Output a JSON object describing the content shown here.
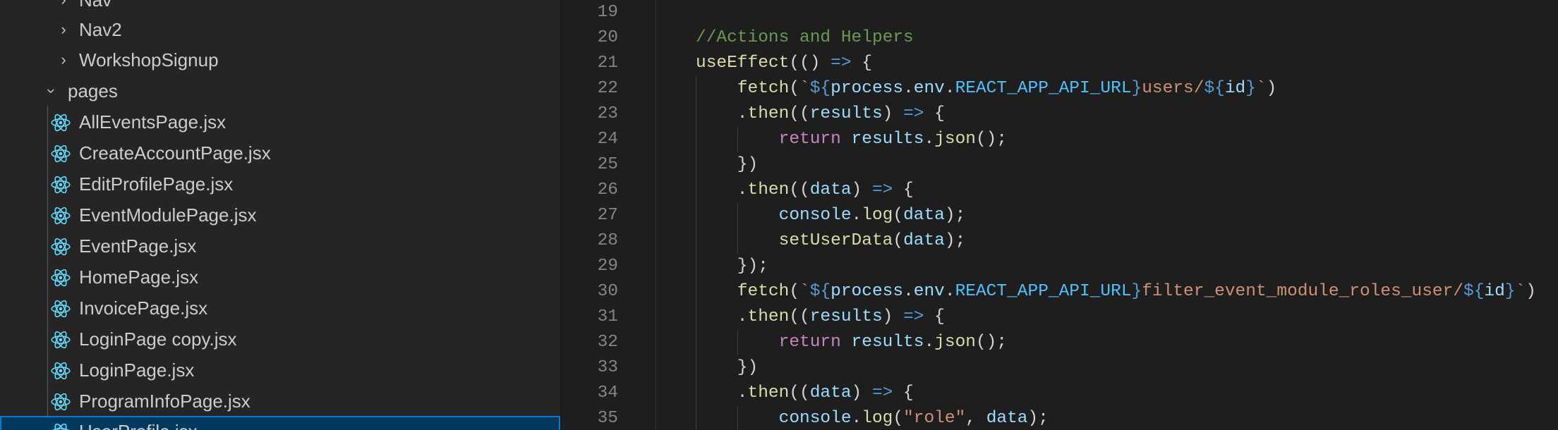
{
  "explorer": {
    "items": [
      {
        "label": "Nav",
        "type": "folder",
        "state": "collapsed",
        "depth": 1
      },
      {
        "label": "Nav2",
        "type": "folder",
        "state": "collapsed",
        "depth": 1
      },
      {
        "label": "WorkshopSignup",
        "type": "folder",
        "state": "collapsed",
        "depth": 1
      },
      {
        "label": "pages",
        "type": "folder",
        "state": "expanded",
        "depth": 0
      },
      {
        "label": "AllEventsPage.jsx",
        "type": "file",
        "icon": "react-icon"
      },
      {
        "label": "CreateAccountPage.jsx",
        "type": "file",
        "icon": "react-icon"
      },
      {
        "label": "EditProfilePage.jsx",
        "type": "file",
        "icon": "react-icon"
      },
      {
        "label": "EventModulePage.jsx",
        "type": "file",
        "icon": "react-icon"
      },
      {
        "label": "EventPage.jsx",
        "type": "file",
        "icon": "react-icon"
      },
      {
        "label": "HomePage.jsx",
        "type": "file",
        "icon": "react-icon"
      },
      {
        "label": "InvoicePage.jsx",
        "type": "file",
        "icon": "react-icon"
      },
      {
        "label": "LoginPage copy.jsx",
        "type": "file",
        "icon": "react-icon"
      },
      {
        "label": "LoginPage.jsx",
        "type": "file",
        "icon": "react-icon"
      },
      {
        "label": "ProgramInfoPage.jsx",
        "type": "file",
        "icon": "react-icon"
      },
      {
        "label": "UserProfile.jsx",
        "type": "file",
        "icon": "react-icon",
        "selected": true
      }
    ]
  },
  "editor": {
    "lines": [
      {
        "num": "19",
        "tokens": []
      },
      {
        "num": "20",
        "tokens": [
          [
            "c-comment",
            "//Actions and Helpers"
          ]
        ]
      },
      {
        "num": "21",
        "tokens": [
          [
            "c-fn",
            "useEffect"
          ],
          [
            "c-punc",
            "(() "
          ],
          [
            "c-arrow",
            "=>"
          ],
          [
            "c-punc",
            " {"
          ]
        ]
      },
      {
        "num": "22",
        "tokens": [
          [
            "c-punc",
            "    "
          ],
          [
            "c-fn",
            "fetch"
          ],
          [
            "c-punc",
            "("
          ],
          [
            "c-str",
            "`"
          ],
          [
            "c-tpl",
            "${"
          ],
          [
            "c-var",
            "process"
          ],
          [
            "c-punc",
            "."
          ],
          [
            "c-var",
            "env"
          ],
          [
            "c-punc",
            "."
          ],
          [
            "c-const",
            "REACT_APP_API_URL"
          ],
          [
            "c-tpl",
            "}"
          ],
          [
            "c-str",
            "users/"
          ],
          [
            "c-tpl",
            "${"
          ],
          [
            "c-var",
            "id"
          ],
          [
            "c-tpl",
            "}"
          ],
          [
            "c-str",
            "`"
          ],
          [
            "c-punc",
            ")"
          ]
        ]
      },
      {
        "num": "23",
        "tokens": [
          [
            "c-punc",
            "    ."
          ],
          [
            "c-fn",
            "then"
          ],
          [
            "c-punc",
            "(("
          ],
          [
            "c-var",
            "results"
          ],
          [
            "c-punc",
            ") "
          ],
          [
            "c-arrow",
            "=>"
          ],
          [
            "c-punc",
            " {"
          ]
        ]
      },
      {
        "num": "24",
        "tokens": [
          [
            "c-punc",
            "        "
          ],
          [
            "c-kw",
            "return"
          ],
          [
            "c-punc",
            " "
          ],
          [
            "c-var",
            "results"
          ],
          [
            "c-punc",
            "."
          ],
          [
            "c-fn",
            "json"
          ],
          [
            "c-punc",
            "();"
          ]
        ]
      },
      {
        "num": "25",
        "tokens": [
          [
            "c-punc",
            "    })"
          ]
        ]
      },
      {
        "num": "26",
        "tokens": [
          [
            "c-punc",
            "    ."
          ],
          [
            "c-fn",
            "then"
          ],
          [
            "c-punc",
            "(("
          ],
          [
            "c-var",
            "data"
          ],
          [
            "c-punc",
            ") "
          ],
          [
            "c-arrow",
            "=>"
          ],
          [
            "c-punc",
            " {"
          ]
        ]
      },
      {
        "num": "27",
        "tokens": [
          [
            "c-punc",
            "        "
          ],
          [
            "c-var",
            "console"
          ],
          [
            "c-punc",
            "."
          ],
          [
            "c-fn",
            "log"
          ],
          [
            "c-punc",
            "("
          ],
          [
            "c-var",
            "data"
          ],
          [
            "c-punc",
            ");"
          ]
        ]
      },
      {
        "num": "28",
        "tokens": [
          [
            "c-punc",
            "        "
          ],
          [
            "c-fn",
            "setUserData"
          ],
          [
            "c-punc",
            "("
          ],
          [
            "c-var",
            "data"
          ],
          [
            "c-punc",
            ");"
          ]
        ]
      },
      {
        "num": "29",
        "tokens": [
          [
            "c-punc",
            "    });"
          ]
        ]
      },
      {
        "num": "30",
        "tokens": [
          [
            "c-punc",
            "    "
          ],
          [
            "c-fn",
            "fetch"
          ],
          [
            "c-punc",
            "("
          ],
          [
            "c-str",
            "`"
          ],
          [
            "c-tpl",
            "${"
          ],
          [
            "c-var",
            "process"
          ],
          [
            "c-punc",
            "."
          ],
          [
            "c-var",
            "env"
          ],
          [
            "c-punc",
            "."
          ],
          [
            "c-const",
            "REACT_APP_API_URL"
          ],
          [
            "c-tpl",
            "}"
          ],
          [
            "c-str",
            "filter_event_module_roles_user/"
          ],
          [
            "c-tpl",
            "${"
          ],
          [
            "c-var",
            "id"
          ],
          [
            "c-tpl",
            "}"
          ],
          [
            "c-str",
            "`"
          ],
          [
            "c-punc",
            ")"
          ]
        ]
      },
      {
        "num": "31",
        "tokens": [
          [
            "c-punc",
            "    ."
          ],
          [
            "c-fn",
            "then"
          ],
          [
            "c-punc",
            "(("
          ],
          [
            "c-var",
            "results"
          ],
          [
            "c-punc",
            ") "
          ],
          [
            "c-arrow",
            "=>"
          ],
          [
            "c-punc",
            " {"
          ]
        ]
      },
      {
        "num": "32",
        "tokens": [
          [
            "c-punc",
            "        "
          ],
          [
            "c-kw",
            "return"
          ],
          [
            "c-punc",
            " "
          ],
          [
            "c-var",
            "results"
          ],
          [
            "c-punc",
            "."
          ],
          [
            "c-fn",
            "json"
          ],
          [
            "c-punc",
            "();"
          ]
        ]
      },
      {
        "num": "33",
        "tokens": [
          [
            "c-punc",
            "    })"
          ]
        ]
      },
      {
        "num": "34",
        "tokens": [
          [
            "c-punc",
            "    ."
          ],
          [
            "c-fn",
            "then"
          ],
          [
            "c-punc",
            "(("
          ],
          [
            "c-var",
            "data"
          ],
          [
            "c-punc",
            ") "
          ],
          [
            "c-arrow",
            "=>"
          ],
          [
            "c-punc",
            " {"
          ]
        ]
      },
      {
        "num": "35",
        "tokens": [
          [
            "c-punc",
            "        "
          ],
          [
            "c-var",
            "console"
          ],
          [
            "c-punc",
            "."
          ],
          [
            "c-fn",
            "log"
          ],
          [
            "c-punc",
            "("
          ],
          [
            "c-str",
            "\"role\""
          ],
          [
            "c-punc",
            ", "
          ],
          [
            "c-var",
            "data"
          ],
          [
            "c-punc",
            ");"
          ]
        ]
      }
    ]
  },
  "colors": {
    "sidebar_bg": "#252526",
    "editor_bg": "#1e1e1e",
    "selection_bg": "#04395e",
    "selection_border": "#0a7ad1",
    "react_icon": "#61dafb"
  }
}
